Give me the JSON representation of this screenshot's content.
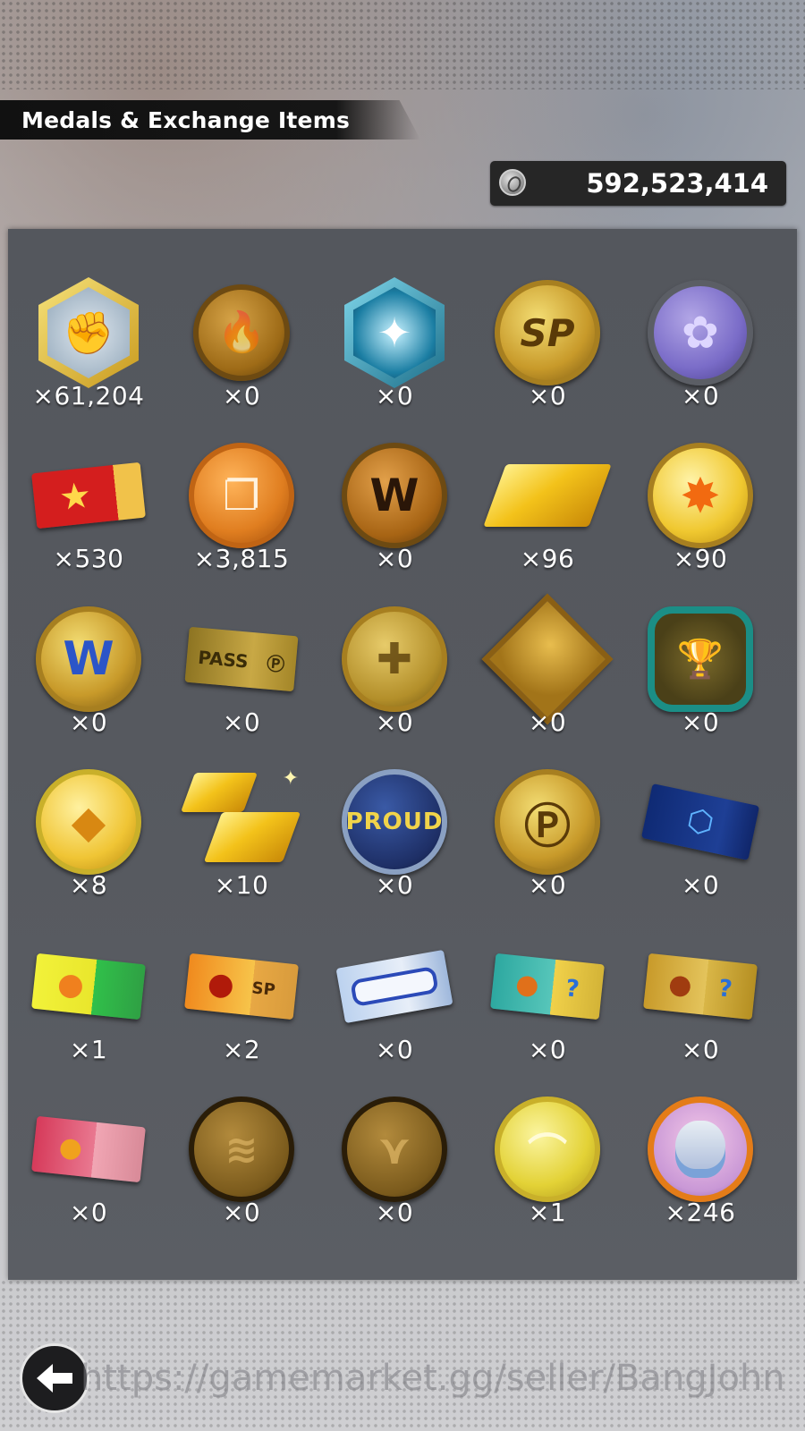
{
  "header": {
    "title": "Medals & Exchange Items"
  },
  "currency": {
    "icon": "zeni-coin-icon",
    "amount": "592,523,414"
  },
  "items": [
    {
      "icon": "fist-hexagon-medal-icon",
      "count": "×61,204"
    },
    {
      "icon": "bronze-flame-medal-icon",
      "count": "×0"
    },
    {
      "icon": "blue-hexagon-sparkle-medal-icon",
      "count": "×0"
    },
    {
      "icon": "sp-gold-medal-icon",
      "count": "×0"
    },
    {
      "icon": "lavender-flower-medal-icon",
      "count": "×0"
    },
    {
      "icon": "red-star-ticket-icon",
      "count": "×530"
    },
    {
      "icon": "orange-cards-medal-icon",
      "count": "×3,815"
    },
    {
      "icon": "bronze-w-medal-icon",
      "count": "×0"
    },
    {
      "icon": "gold-bars-icon",
      "count": "×96"
    },
    {
      "icon": "yellow-explosion-medal-icon",
      "count": "×90"
    },
    {
      "icon": "blue-w-gold-medal-icon",
      "count": "×0"
    },
    {
      "icon": "pass-ticket-icon",
      "count": "×0"
    },
    {
      "icon": "puzzle-gold-medal-icon",
      "count": "×0"
    },
    {
      "icon": "flame-diamond-medal-icon",
      "count": "×0"
    },
    {
      "icon": "trophy-octagon-medal-icon",
      "count": "×0"
    },
    {
      "icon": "gem-gold-medal-icon",
      "count": "×8"
    },
    {
      "icon": "stacked-gold-bars-icon",
      "count": "×10"
    },
    {
      "icon": "proud-blue-medal-icon",
      "count": "×0"
    },
    {
      "icon": "p-gold-medal-icon",
      "count": "×0"
    },
    {
      "icon": "blue-hexagon-ticket-icon",
      "count": "×0"
    },
    {
      "icon": "green-fireball-ticket-icon",
      "count": "×1"
    },
    {
      "icon": "sp-fireball-ticket-icon",
      "count": "×2"
    },
    {
      "icon": "blank-blue-ticket-icon",
      "count": "×0"
    },
    {
      "icon": "teal-fireball-ticket-icon",
      "count": "×0"
    },
    {
      "icon": "gold-fireball-ticket-icon",
      "count": "×0"
    },
    {
      "icon": "pink-fireball-ticket-icon",
      "count": "×0"
    },
    {
      "icon": "bandage-bronze-medal-icon",
      "count": "×0"
    },
    {
      "icon": "gi-bronze-medal-icon",
      "count": "×0"
    },
    {
      "icon": "yellow-swoosh-medal-icon",
      "count": "×1"
    },
    {
      "icon": "character-portrait-medal-icon",
      "count": "×246"
    }
  ],
  "nav": {
    "back_icon": "back-arrow-icon"
  },
  "watermark": "https://gamemarket.gg/seller/BangJohn"
}
